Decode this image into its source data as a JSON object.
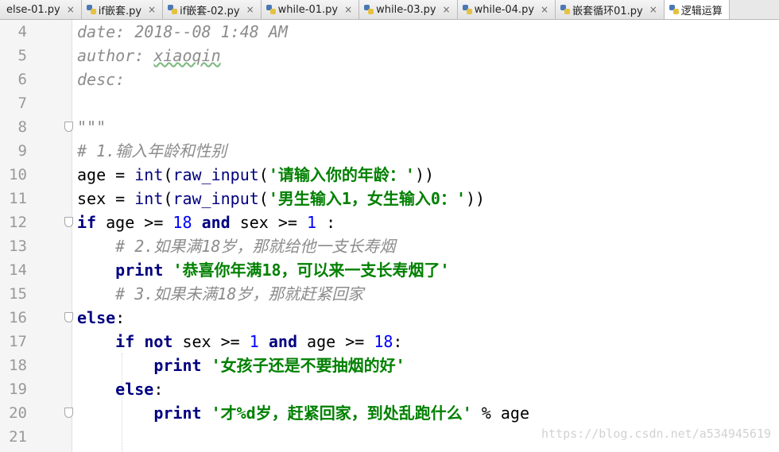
{
  "tabs": [
    {
      "label": "else-01.py",
      "icon": "python-file-icon",
      "close": "×"
    },
    {
      "label": "if嵌套.py",
      "icon": "python-file-icon",
      "close": "×"
    },
    {
      "label": "if嵌套-02.py",
      "icon": "python-file-icon",
      "close": "×"
    },
    {
      "label": "while-01.py",
      "icon": "python-file-icon",
      "close": "×"
    },
    {
      "label": "while-03.py",
      "icon": "python-file-icon",
      "close": "×"
    },
    {
      "label": "while-04.py",
      "icon": "python-file-icon",
      "close": "×"
    },
    {
      "label": "嵌套循环01.py",
      "icon": "python-file-icon",
      "close": "×"
    },
    {
      "label": "逻辑运算",
      "icon": "python-file-icon",
      "close": ""
    }
  ],
  "editor": {
    "lines": [
      {
        "n": "4",
        "tokens": [
          {
            "t": "date: 2018--08 1:48 AM",
            "c": "cm"
          }
        ]
      },
      {
        "n": "5",
        "tokens": [
          {
            "t": "author: ",
            "c": "cm"
          },
          {
            "t": "xiaoqin",
            "c": "cm warn"
          }
        ]
      },
      {
        "n": "6",
        "tokens": [
          {
            "t": "desc:",
            "c": "cm"
          }
        ]
      },
      {
        "n": "7",
        "tokens": []
      },
      {
        "n": "8",
        "tokens": [
          {
            "t": "\"\"\"",
            "c": "cm"
          }
        ]
      },
      {
        "n": "9",
        "tokens": [
          {
            "t": "# 1.输入年龄和性别",
            "c": "cm"
          }
        ]
      },
      {
        "n": "10",
        "tokens": [
          {
            "t": "age = ",
            "c": "nm"
          },
          {
            "t": "int",
            "c": "bi"
          },
          {
            "t": "(",
            "c": "nm"
          },
          {
            "t": "raw_input",
            "c": "bi"
          },
          {
            "t": "(",
            "c": "nm"
          },
          {
            "t": "'请输入你的年龄：'",
            "c": "str"
          },
          {
            "t": "))",
            "c": "nm"
          }
        ]
      },
      {
        "n": "11",
        "tokens": [
          {
            "t": "sex = ",
            "c": "nm"
          },
          {
            "t": "int",
            "c": "bi"
          },
          {
            "t": "(",
            "c": "nm"
          },
          {
            "t": "raw_input",
            "c": "bi"
          },
          {
            "t": "(",
            "c": "nm"
          },
          {
            "t": "'男生输入1，女生输入0：'",
            "c": "str"
          },
          {
            "t": "))",
            "c": "nm"
          }
        ]
      },
      {
        "n": "12",
        "tokens": [
          {
            "t": "if",
            "c": "kw"
          },
          {
            "t": " age >= ",
            "c": "nm"
          },
          {
            "t": "18",
            "c": "num"
          },
          {
            "t": " ",
            "c": "nm"
          },
          {
            "t": "and",
            "c": "kw"
          },
          {
            "t": " sex >= ",
            "c": "nm"
          },
          {
            "t": "1",
            "c": "num"
          },
          {
            "t": " :",
            "c": "nm"
          }
        ]
      },
      {
        "n": "13",
        "tokens": [
          {
            "t": "    ",
            "c": "nm"
          },
          {
            "t": "# 2.如果满18岁，那就给他一支长寿烟",
            "c": "cm"
          }
        ]
      },
      {
        "n": "14",
        "tokens": [
          {
            "t": "    ",
            "c": "nm"
          },
          {
            "t": "print",
            "c": "kw"
          },
          {
            "t": " ",
            "c": "nm"
          },
          {
            "t": "'恭喜你年满18，可以来一支长寿烟了'",
            "c": "str"
          }
        ]
      },
      {
        "n": "15",
        "tokens": [
          {
            "t": "    ",
            "c": "nm"
          },
          {
            "t": "# 3.如果未满18岁，那就赶紧回家",
            "c": "cm"
          }
        ]
      },
      {
        "n": "16",
        "tokens": [
          {
            "t": "else",
            "c": "kw"
          },
          {
            "t": ":",
            "c": "nm"
          }
        ]
      },
      {
        "n": "17",
        "tokens": [
          {
            "t": "    ",
            "c": "nm"
          },
          {
            "t": "if",
            "c": "kw"
          },
          {
            "t": " ",
            "c": "nm"
          },
          {
            "t": "not",
            "c": "kw"
          },
          {
            "t": " sex >= ",
            "c": "nm"
          },
          {
            "t": "1",
            "c": "num"
          },
          {
            "t": " ",
            "c": "nm"
          },
          {
            "t": "and",
            "c": "kw"
          },
          {
            "t": " age >= ",
            "c": "nm"
          },
          {
            "t": "18",
            "c": "num"
          },
          {
            "t": ":",
            "c": "nm"
          }
        ]
      },
      {
        "n": "18",
        "tokens": [
          {
            "t": "        ",
            "c": "nm"
          },
          {
            "t": "print",
            "c": "kw"
          },
          {
            "t": " ",
            "c": "nm"
          },
          {
            "t": "'女孩子还是不要抽烟的好'",
            "c": "str"
          }
        ]
      },
      {
        "n": "19",
        "tokens": [
          {
            "t": "    ",
            "c": "nm"
          },
          {
            "t": "else",
            "c": "kw"
          },
          {
            "t": ":",
            "c": "nm"
          }
        ]
      },
      {
        "n": "20",
        "tokens": [
          {
            "t": "        ",
            "c": "nm"
          },
          {
            "t": "print",
            "c": "kw"
          },
          {
            "t": " ",
            "c": "nm"
          },
          {
            "t": "'才%d岁，赶紧回家，到处乱跑什么'",
            "c": "str"
          },
          {
            "t": " % age",
            "c": "nm"
          }
        ]
      },
      {
        "n": "21",
        "tokens": []
      }
    ]
  },
  "watermark": "https://blog.csdn.net/a534945619"
}
